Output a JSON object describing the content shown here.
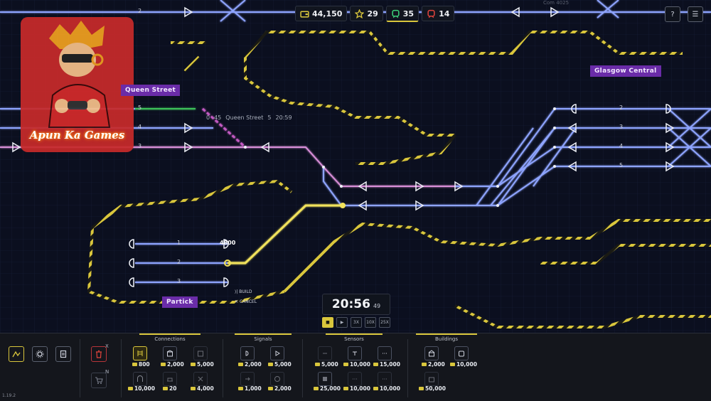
{
  "hud": {
    "money": "44,150",
    "stars": "29",
    "trains": "35",
    "alerts": "14"
  },
  "top_buttons": {
    "help": "?",
    "menu": "☰"
  },
  "map": {
    "top_line_platform": "2",
    "top_right_ghost": "Com 4025",
    "stations": [
      {
        "name": "Queen Street",
        "label": "Queen Street"
      },
      {
        "name": "Glasgow Central",
        "label": "Glasgow Central"
      },
      {
        "name": "Partick",
        "label": "Partick"
      }
    ],
    "left_platforms": [
      "5",
      "4",
      "3"
    ],
    "right_platforms": [
      "2",
      "3",
      "4",
      "5"
    ],
    "partick_platforms": [
      "1",
      "2",
      "3"
    ],
    "departure_hint": {
      "time_left": "0",
      "time_partial": "45",
      "destination": "Queen Street",
      "platform": "5",
      "clock": "20:59"
    },
    "build_cost_popup": "4800",
    "context": {
      "build": "BUILD",
      "cancel": "CANCEL"
    }
  },
  "clock": {
    "time": "20:56",
    "seconds": "49"
  },
  "speeds": [
    "3X",
    "10X",
    "25X"
  ],
  "toolbar": {
    "delete_key": "X",
    "buy_key": "N",
    "categories": [
      {
        "name": "Connections"
      },
      {
        "name": "Signals"
      },
      {
        "name": "Sensors"
      },
      {
        "name": "Buildings"
      }
    ],
    "connections_costs": [
      "800",
      "2,000",
      "5,000",
      "10,000",
      "20",
      "4,000"
    ],
    "signals_costs": [
      "2,000",
      "5,000",
      "1,000",
      "2,000"
    ],
    "sensors_costs": [
      "5,000",
      "10,000",
      "15,000",
      "25,000",
      "10,000",
      "10,000"
    ],
    "buildings_costs": [
      "2,000",
      "10,000",
      "50,000"
    ]
  },
  "logo": {
    "text": "Apun Ka Games"
  },
  "version": "1.19.2",
  "colors": {
    "accent": "#d9c63c",
    "track_blue": "#8ea4ff",
    "track_pink": "#d88ed8",
    "station": "#6a2ca8",
    "build_path": "#f1e25c"
  }
}
